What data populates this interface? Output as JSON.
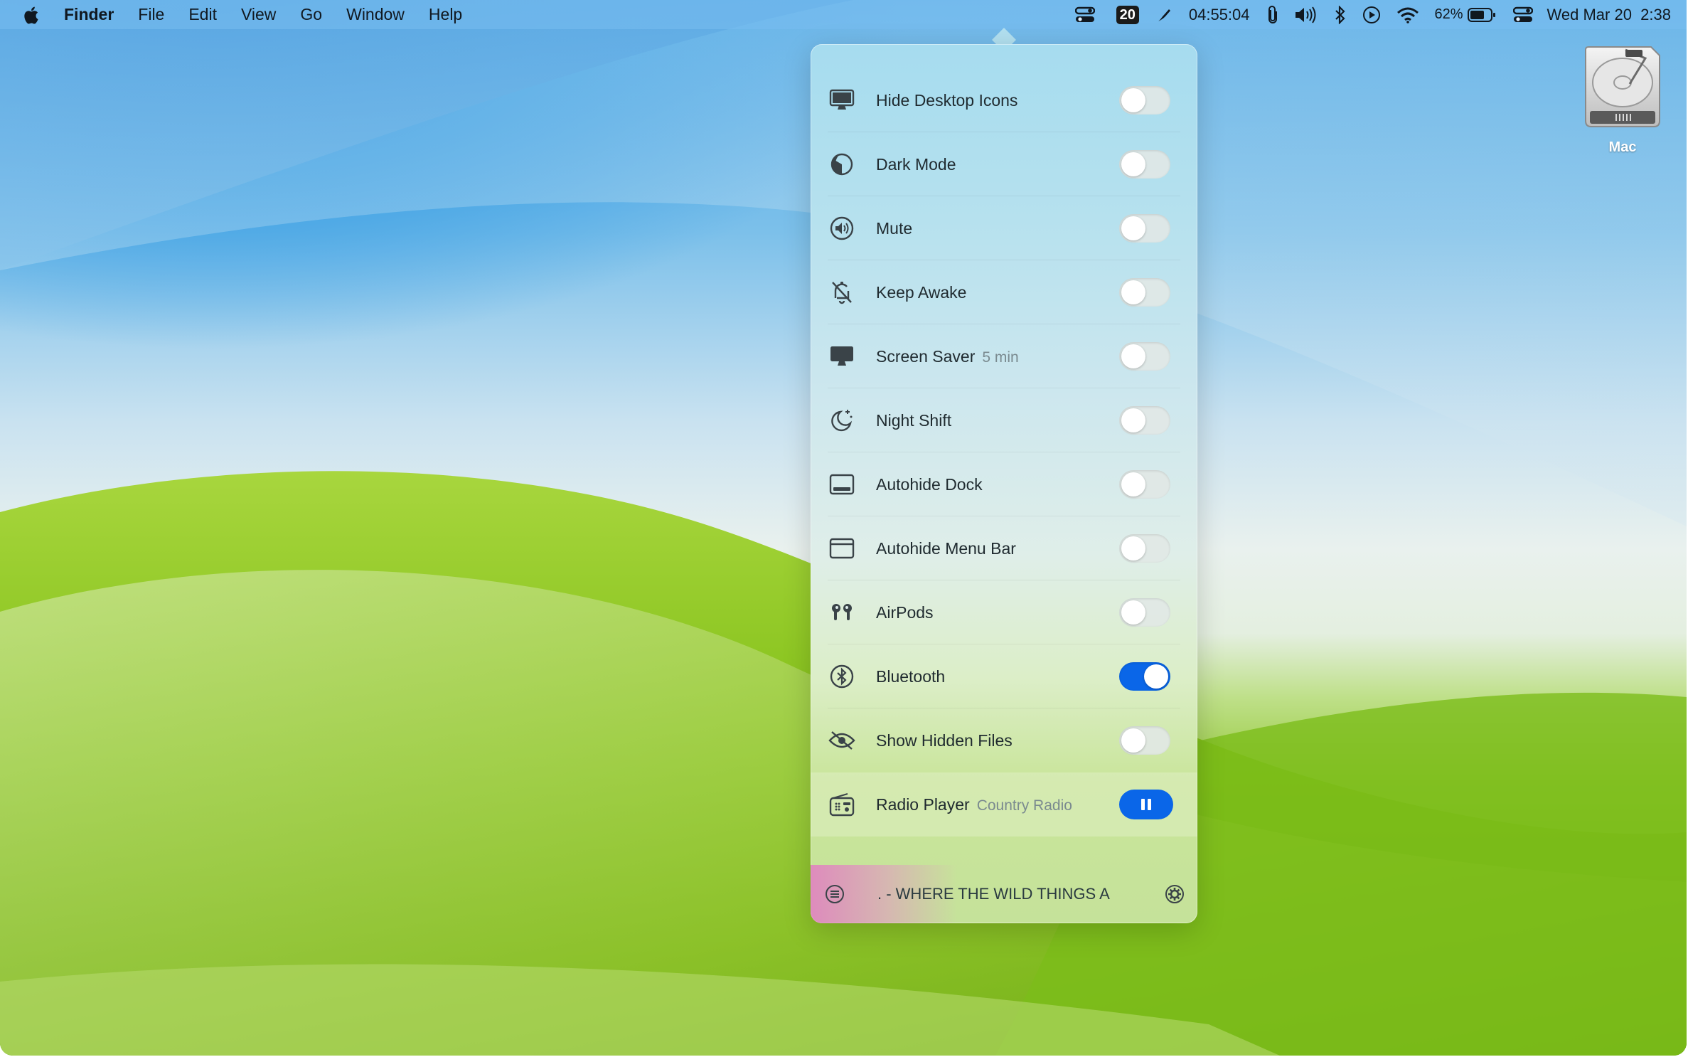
{
  "menubar": {
    "app_name": "Finder",
    "menus": [
      "File",
      "Edit",
      "View",
      "Go",
      "Window",
      "Help"
    ],
    "badge": "20",
    "clock_timer": "04:55:04",
    "battery_percent": "62%",
    "datetime": "Wed Mar 20  2:38",
    "icons": [
      "apple-icon",
      "toggles-icon",
      "calendar-badge",
      "pen-icon",
      "paperclip-icon",
      "volume-icon",
      "bluetooth-icon",
      "play-icon",
      "wifi-icon",
      "battery-icon",
      "control-center-icon"
    ]
  },
  "drive": {
    "label": "Mac"
  },
  "panel": {
    "rows": [
      {
        "label": "Hide Desktop Icons",
        "icon": "desktop-icon",
        "on": false
      },
      {
        "label": "Dark Mode",
        "icon": "dark-mode-icon",
        "on": false
      },
      {
        "label": "Mute",
        "icon": "speaker-icon",
        "on": false
      },
      {
        "label": "Keep Awake",
        "icon": "sleep-off-icon",
        "on": false
      },
      {
        "label": "Screen Saver",
        "sub": "5 min",
        "icon": "monitor-icon",
        "on": false
      },
      {
        "label": "Night Shift",
        "icon": "moon-icon",
        "on": false
      },
      {
        "label": "Autohide Dock",
        "icon": "dock-icon",
        "on": false
      },
      {
        "label": "Autohide Menu Bar",
        "icon": "window-icon",
        "on": false
      },
      {
        "label": "AirPods",
        "icon": "airpods-icon",
        "on": false
      },
      {
        "label": "Bluetooth",
        "icon": "bluetooth-icon",
        "on": true
      },
      {
        "label": "Show Hidden Files",
        "icon": "eye-slash-icon",
        "on": false
      }
    ],
    "radio": {
      "label": "Radio Player",
      "sub": "Country Radio",
      "state": "playing"
    },
    "now_playing": ". - WHERE THE WILD THINGS A"
  },
  "colors": {
    "accent": "#0a66e8"
  }
}
